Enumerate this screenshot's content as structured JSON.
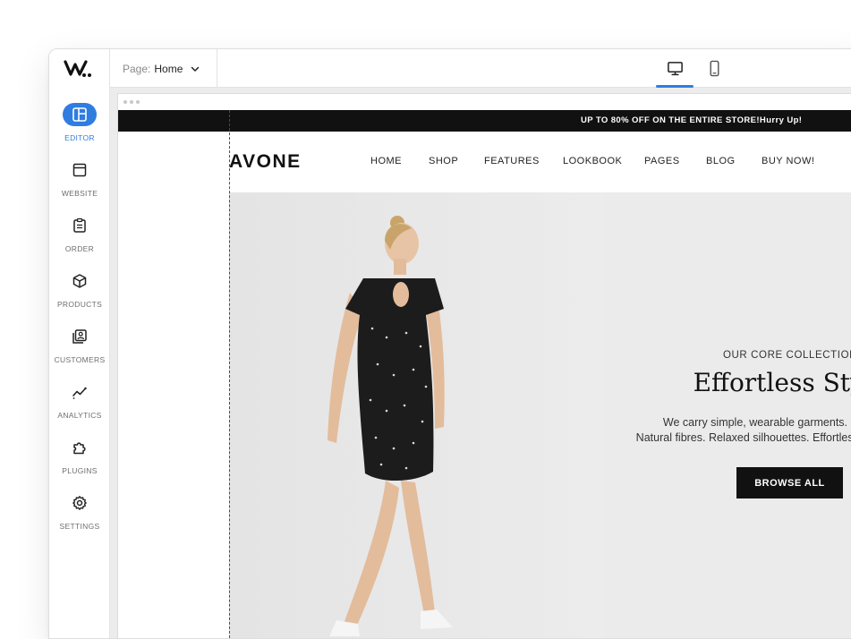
{
  "sidebar": {
    "logo_icon": "wix-logo-icon",
    "items": [
      {
        "label": "EDITOR",
        "icon": "layout-icon",
        "active": true
      },
      {
        "label": "WEBSITE",
        "icon": "browser-window-icon"
      },
      {
        "label": "ORDER",
        "icon": "clipboard-icon"
      },
      {
        "label": "PRODUCTS",
        "icon": "box-icon"
      },
      {
        "label": "CUSTOMERS",
        "icon": "contacts-icon"
      },
      {
        "label": "ANALYTICS",
        "icon": "trend-chart-icon"
      },
      {
        "label": "PLUGINS",
        "icon": "puzzle-icon"
      },
      {
        "label": "SETTINGS",
        "icon": "gear-icon"
      }
    ]
  },
  "topbar": {
    "page_label": "Page:",
    "page_value": "Home",
    "devices": [
      {
        "icon": "desktop-icon",
        "active": true
      },
      {
        "icon": "mobile-icon",
        "active": false
      }
    ]
  },
  "site": {
    "promo": "UP TO 80% OFF ON THE ENTIRE STORE!Hurry Up!",
    "brand": "AVONE",
    "nav": [
      "HOME",
      "SHOP",
      "FEATURES",
      "LOOKBOOK",
      "PAGES",
      "BLOG",
      "BUY NOW!"
    ],
    "hero": {
      "eyebrow": "OUR CORE COLLECTION",
      "title": "Effortless Style",
      "desc_line1": "We carry simple, wearable garments. Neutral colors.",
      "desc_line2": "Natural fibres. Relaxed silhouettes. Effortless, everyday fashion",
      "cta": "BROWSE ALL"
    }
  },
  "colors": {
    "accent": "#2f7de1",
    "promo_bg": "#111111",
    "hero_bg": "#ebebeb"
  }
}
